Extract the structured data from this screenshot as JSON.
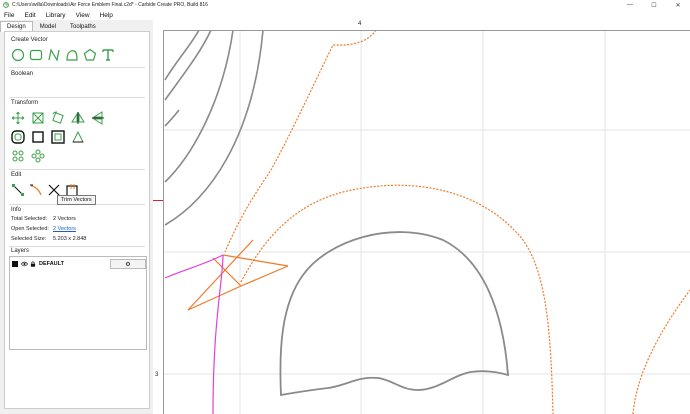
{
  "window": {
    "title": "C:\\Users\\willa\\Downloads\\Air Force Emblem Final.c2d* - Carbide Create PRO, Build 816",
    "minimize": "—",
    "maximize": "☐",
    "close": "✕"
  },
  "menu": [
    "File",
    "Edit",
    "Library",
    "View",
    "Help"
  ],
  "tabs": [
    {
      "label": "Design",
      "active": true
    },
    {
      "label": "Model",
      "active": false
    },
    {
      "label": "Toolpaths",
      "active": false
    }
  ],
  "sections": {
    "create_vector": "Create Vector",
    "boolean": "Boolean",
    "transform": "Transform",
    "edit": "Edit",
    "info": "Info",
    "layers": "Layers"
  },
  "info": {
    "total_selected_label": "Total Selected:",
    "total_selected_value": "2 Vectors",
    "open_selected_label": "Open Selected:",
    "open_selected_value": "2 Vectors",
    "selected_size_label": "Selected Size:",
    "selected_size_value": "5.203 x 2.848"
  },
  "layers": [
    {
      "name": "DEFAULT",
      "color": "#111111"
    }
  ],
  "tooltip": "Trim Vectors",
  "ruler": {
    "top_label": "4",
    "left_label": "3"
  },
  "colors": {
    "tool_green": "#3aa04a",
    "selection_orange": "#f07a2a",
    "curve_gray": "#8a8a8a",
    "magenta": "#e040e0",
    "ruler_red": "#e02020"
  }
}
